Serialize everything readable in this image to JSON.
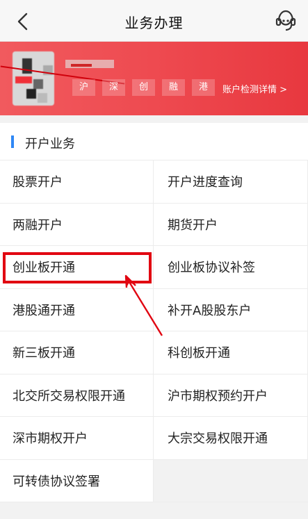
{
  "header": {
    "title": "业务办理",
    "back_icon": "chevron-left-icon",
    "service_icon": "customer-service-icon"
  },
  "banner": {
    "markets": [
      "沪",
      "深",
      "创",
      "融",
      "港"
    ],
    "detail_link": "账户检测详情 >",
    "accent": "#ee4a50"
  },
  "section": {
    "title": "开户业务",
    "accent": "#2f87f5"
  },
  "services": [
    "股票开户",
    "开户进度查询",
    "两融开户",
    "期货开户",
    "创业板开通",
    "创业板协议补签",
    "港股通开通",
    "补开A股股东户",
    "新三板开通",
    "科创板开通",
    "北交所交易权限开通",
    "沪市期权预约开户",
    "深市期权开户",
    "大宗交易权限开通",
    "可转债协议签署"
  ],
  "annotation": {
    "highlight_color": "#e10511",
    "highlighted_item": "创业板开通"
  }
}
